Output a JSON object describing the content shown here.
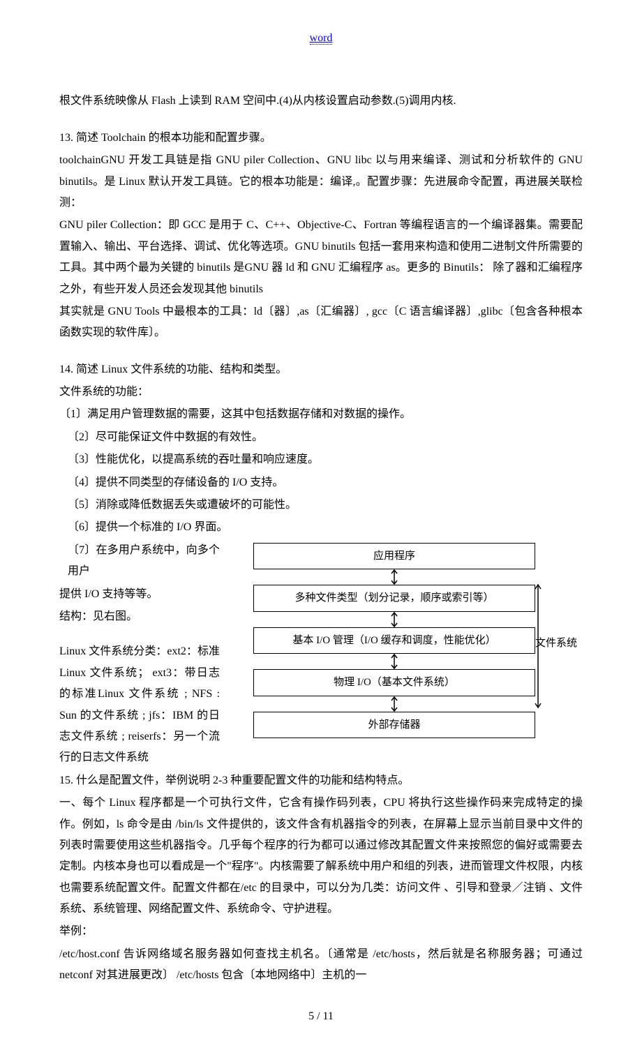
{
  "header": {
    "word": "word"
  },
  "p1": "根文件系统映像从 Flash 上读到 RAM 空间中.(4)从内核设置启动参数.(5)调用内核.",
  "q13_title": "13. 简述 Toolchain 的根本功能和配置步骤。",
  "q13_a": "toolchainGNU 开发工具链是指 GNU piler Collection、GNU libc 以与用来编译、测试和分析软件的 GNU binutils。是 Linux 默认开发工具链。它的根本功能是：编译,。配置步骤：先进展命令配置，再进展关联检测：",
  "q13_b": "GNU piler Collection：即 GCC 是用于 C、C++、Objective-C、Fortran 等编程语言的一个编译器集。需要配置输入、输出、平台选择、调试、优化等选项。GNU binutils 包括一套用来构造和使用二进制文件所需要的工具。其中两个最为关键的 binutils 是GNU 器 ld 和 GNU 汇编程序 as。更多的 Binutils： 除了器和汇编程序之外，有些开发人员还会发现其他 binutils",
  "q13_c": "其实就是 GNU Tools 中最根本的工具：ld〔器〕,as〔汇编器〕, gcc〔C 语言编译器〕,glibc〔包含各种根本函数实现的软件库〕。",
  "q14_title": "14. 简述 Linux 文件系统的功能、结构和类型。",
  "q14_func": "文件系统的功能：",
  "q14_f1": "〔1〕满足用户管理数据的需要，这其中包括数据存储和对数据的操作。",
  "q14_f2": "〔2〕尽可能保证文件中数据的有效性。",
  "q14_f3": "〔3〕性能优化，以提高系统的吞吐量和响应速度。",
  "q14_f4": "〔4〕提供不同类型的存储设备的 I/O 支持。",
  "q14_f5": "〔5〕消除或降低数据丢失或遭破坏的可能性。",
  "q14_f6": "〔6〕提供一个标准的 I/O 界面。",
  "q14_f7a": "〔7〕在多用户系统中，向多个用户",
  "q14_f7b": "提供 I/O 支持等等。",
  "q14_struct": "结构：见右图。",
  "q14_types": "Linux 文件系统分类：ext2：标准Linux 文件系统； ext3：带日志的标准Linux 文件系统 ; NFS : Sun 的文件系统 ; jfs：IBM 的日志文件系统 ; reiserfs：另一个流行的日志文件系统",
  "diagram": {
    "b1": "应用程序",
    "b2": "多种文件类型（划分记录，顺序或索引等）",
    "b3": "基本 I/O 管理（I/O 缓存和调度，性能优化）",
    "b4": "物理 I/O（基本文件系统）",
    "b5": "外部存储器",
    "label": "文件系统"
  },
  "q15_title": "15. 什么是配置文件，举例说明 2-3 种重要配置文件的功能和结构特点。",
  "q15_a": "一、每个 Linux 程序都是一个可执行文件，它含有操作码列表，CPU 将执行这些操作码来完成特定的操作。例如，ls 命令是由 /bin/ls 文件提供的，该文件含有机器指令的列表，在屏幕上显示当前目录中文件的列表时需要使用这些机器指令。几乎每个程序的行为都可以通过修改其配置文件来按照您的偏好或需要去定制。内核本身也可以看成是一个\"程序\"。内核需要了解系统中用户和组的列表，进而管理文件权限，内核也需要系统配置文件。配置文件都在/etc 的目录中，可以分为几类：访问文件 、引导和登录／注销 、文件系统、系统管理、网络配置文件、系统命令、守护进程。",
  "q15_b": "举例：",
  "q15_c": "/etc/host.conf 告诉网络域名服务器如何查找主机名。〔通常是 /etc/hosts，然后就是名称服务器；可通过 netconf 对其进展更改〕  /etc/hosts 包含〔本地网络中〕主机的一",
  "footer": {
    "page": "5 / 11"
  }
}
